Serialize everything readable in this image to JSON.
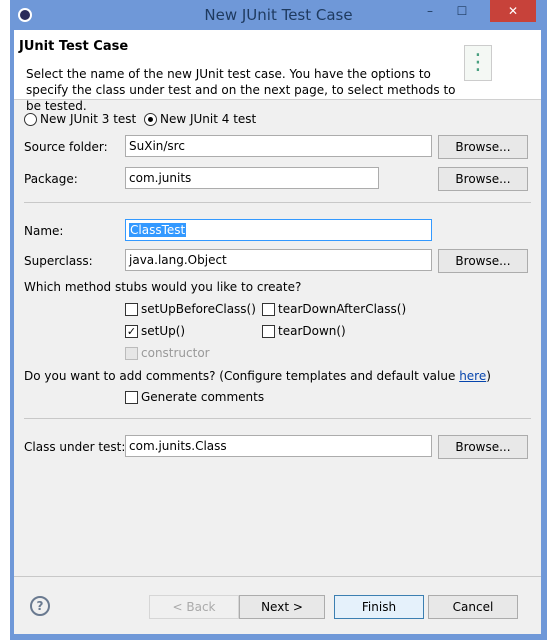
{
  "window": {
    "title": "New JUnit Test Case",
    "minimize": "–",
    "maximize": "☐",
    "close": "✕"
  },
  "header": {
    "title": "JUnit Test Case",
    "description": "Select the name of the new JUnit test case. You have the options to specify the class under test and on the next page, to select methods to be tested."
  },
  "version": {
    "junit3": "New JUnit 3 test",
    "junit4": "New JUnit 4 test",
    "selected": "junit4"
  },
  "source_folder": {
    "label": "Source folder:",
    "value": "SuXin/src",
    "browse": "Browse..."
  },
  "package": {
    "label": "Package:",
    "value": "com.junits",
    "browse": "Browse..."
  },
  "name": {
    "label": "Name:",
    "value": "ClassTest"
  },
  "superclass": {
    "label": "Superclass:",
    "value": "java.lang.Object",
    "browse": "Browse..."
  },
  "stubs": {
    "question": "Which method stubs would you like to create?",
    "setUpBeforeClass": "setUpBeforeClass()",
    "tearDownAfterClass": "tearDownAfterClass()",
    "setUp": "setUp()",
    "tearDown": "tearDown()",
    "constructor": "constructor"
  },
  "comments": {
    "question_pre": "Do you want to add comments? (Configure templates and default value ",
    "link": "here",
    "question_post": ")",
    "generate": "Generate comments"
  },
  "class_under_test": {
    "label": "Class under test:",
    "value": "com.junits.Class",
    "browse": "Browse..."
  },
  "footer": {
    "help": "?",
    "back": "< Back",
    "next": "Next >",
    "finish": "Finish",
    "cancel": "Cancel"
  }
}
